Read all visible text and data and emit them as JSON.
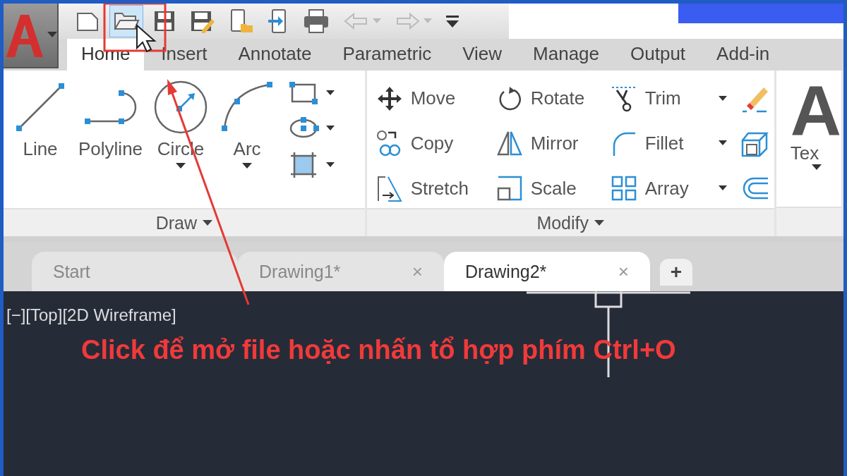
{
  "quick_access_toolbar": [
    {
      "hovered": false,
      "dropdown": false
    },
    {
      "hovered": true,
      "dropdown": false
    },
    {
      "hovered": false,
      "dropdown": false
    },
    {
      "hovered": false,
      "dropdown": false
    },
    {
      "hovered": false,
      "dropdown": false
    },
    {
      "hovered": false,
      "dropdown": false
    },
    {
      "hovered": false,
      "dropdown": false
    },
    {
      "hovered": false,
      "dropdown": true
    },
    {
      "hovered": false,
      "dropdown": true
    },
    {
      "hovered": false,
      "dropdown": false
    }
  ],
  "ribbon_tabs": [
    {
      "label": "Home",
      "selected": true
    },
    {
      "label": "Insert",
      "selected": false
    },
    {
      "label": "Annotate",
      "selected": false
    },
    {
      "label": "Parametric",
      "selected": false
    },
    {
      "label": "View",
      "selected": false
    },
    {
      "label": "Manage",
      "selected": false
    },
    {
      "label": "Output",
      "selected": false
    },
    {
      "label": "Add-in",
      "selected": false
    }
  ],
  "draw_panel": {
    "title": "Draw",
    "large_tools": [
      {
        "label": "Line",
        "dropdown": false
      },
      {
        "label": "Polyline",
        "dropdown": false
      },
      {
        "label": "Circle",
        "dropdown": true
      },
      {
        "label": "Arc",
        "dropdown": true
      }
    ],
    "small_tools": [
      {
        "dropdown": true
      },
      {
        "dropdown": true
      },
      {
        "dropdown": true
      }
    ]
  },
  "modify_panel": {
    "title": "Modify",
    "tools": [
      {
        "label": "Move",
        "dropdown": false
      },
      {
        "label": "Rotate",
        "dropdown": false
      },
      {
        "label": "Trim",
        "dropdown": true
      },
      {
        "label": "Copy",
        "dropdown": false
      },
      {
        "label": "Mirror",
        "dropdown": false
      },
      {
        "label": "Fillet",
        "dropdown": true
      },
      {
        "label": "Stretch",
        "dropdown": false
      },
      {
        "label": "Scale",
        "dropdown": false
      },
      {
        "label": "Array",
        "dropdown": true
      }
    ]
  },
  "annotation_panel": {
    "glyph": "A",
    "label": "Tex"
  },
  "document_tabs": [
    {
      "label": "Start",
      "selected": false
    },
    {
      "label": "Drawing1*",
      "selected": false,
      "close": "×"
    },
    {
      "label": "Drawing2*",
      "selected": true,
      "close": "×"
    }
  ],
  "new_tab": "+",
  "viewport": {
    "label": "[−][Top][2D Wireframe]"
  },
  "annotation": {
    "text": "Click để mở file hoặc nhấn tổ hợp phím Ctrl+O"
  }
}
